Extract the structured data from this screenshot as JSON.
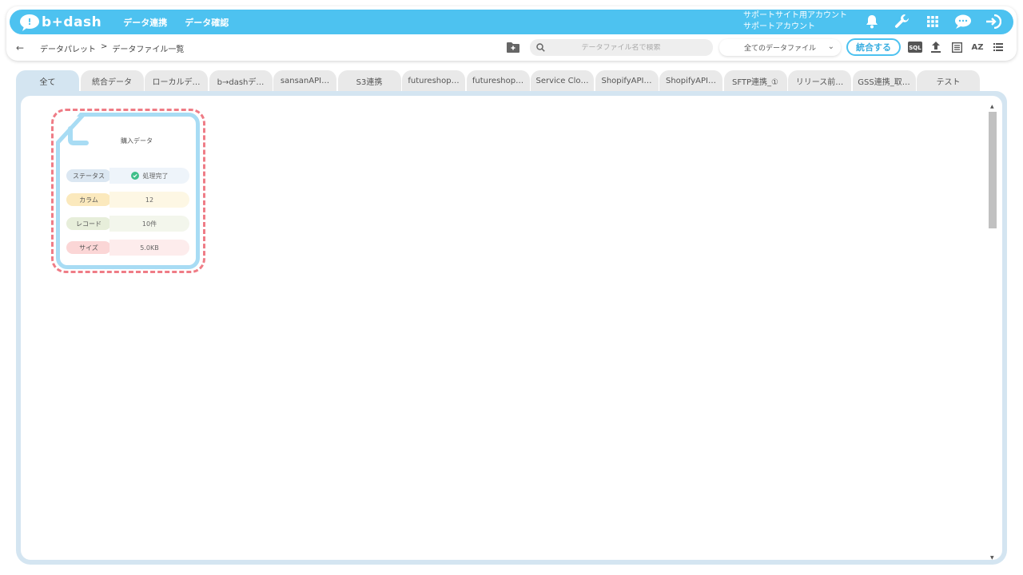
{
  "app": {
    "logo_text": "b+dash",
    "nav": [
      "データ連携",
      "データ確認"
    ],
    "account_line1": "サポートサイト用アカウント",
    "account_line2": "サポートアカウント"
  },
  "icons": {
    "top": [
      "bell-icon",
      "wrench-icon",
      "grid-icon",
      "chat-icon",
      "logout-icon"
    ],
    "tools": [
      "sql-icon",
      "upload-icon",
      "list-view-icon",
      "sort-az-icon",
      "menu-list-icon"
    ]
  },
  "toolbar": {
    "back": "←",
    "breadcrumb_1": "データパレット",
    "breadcrumb_sep": ">",
    "breadcrumb_2": "データファイル一覧",
    "search_placeholder": "データファイル名で検索",
    "filter_selected": "全てのデータファイル",
    "merge_label": "統合する",
    "sql_label": "SQL",
    "az_label": "AZ"
  },
  "tabs": [
    "全て",
    "統合データ",
    "ローカルデ…",
    "b→dashデ…",
    "sansanAPI…",
    "S3連携",
    "futureshop…",
    "futureshop…",
    "Service Clo…",
    "ShopifyAPI…",
    "ShopifyAPI…",
    "SFTP連携_①",
    "リリース前…",
    "GSS連携_取…",
    "テスト"
  ],
  "card": {
    "title": "購入データ",
    "status_label": "ステータス",
    "status_value": "処理完了",
    "column_label": "カラム",
    "column_value": "12",
    "record_label": "レコード",
    "record_value": "10件",
    "size_label": "サイズ",
    "size_value": "5.0KB"
  },
  "colors": {
    "primary": "#4dc2f0",
    "panel": "#d4e5f1",
    "selected_outline": "#ef7c86",
    "status_ok": "#3fbf8a"
  }
}
